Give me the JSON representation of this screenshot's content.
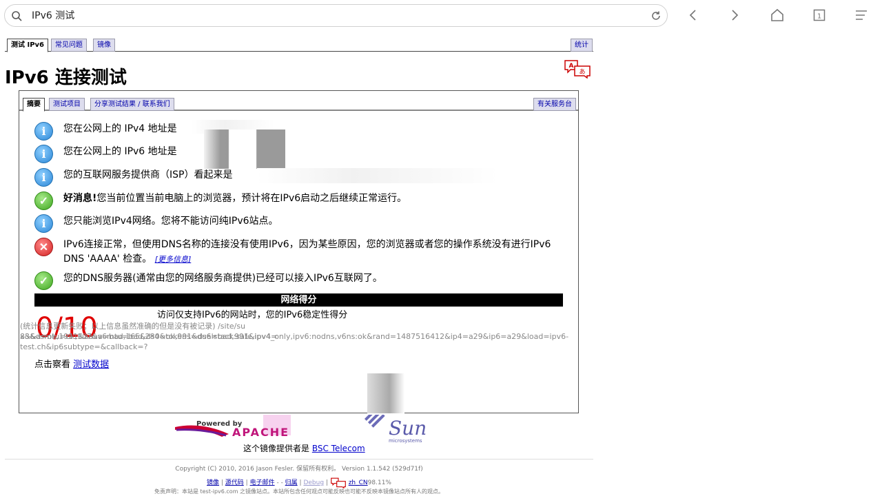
{
  "browser": {
    "url": "IPv6 测试"
  },
  "tabs": {
    "top": [
      "测试 IPv6",
      "常见问题",
      "镜像"
    ],
    "stats": "统计"
  },
  "page": {
    "title": "IPv6 连接测试"
  },
  "inner_tabs": {
    "items": [
      "摘要",
      "测试项目",
      "分享测试结果 / 联系我们"
    ],
    "helpdesk": "有关服务台"
  },
  "results": [
    {
      "icon": "info-icon",
      "text": "您在公网上的 IPv4 地址是"
    },
    {
      "icon": "info-icon",
      "text": "您在公网上的 IPv6 地址是"
    },
    {
      "icon": "info-icon",
      "text": "您的互联网服务提供商（ISP）看起来是"
    },
    {
      "icon": "check-icon",
      "bold": "好消息!",
      "text": "您当前位置当前电脑上的浏览器，预计将在IPv6启动之后继续正常运行。"
    },
    {
      "icon": "info-icon",
      "text": "您只能浏览IPv4网络。您将不能访问纯IPv6站点。"
    },
    {
      "icon": "error-icon",
      "text": "IPv6连接正常，但使用DNS名称的连接没有使用IPv6，因为某些原因，您的浏览器或者您的操作系统没有进行IPv6 DNS 'AAAA' 检查。",
      "link": "[更多信息]"
    },
    {
      "icon": "check-icon",
      "text": "您的DNS服务器(通常由您的网络服务商提供)已经可以接入IPv6互联网了。"
    }
  ],
  "score": {
    "header": "网络得分",
    "value": "0/10",
    "description": "访问仅支持IPv6的网站时，您的IPv6稳定性得分"
  },
  "testdata": {
    "prefix": "点击察看",
    "link": "测试数据"
  },
  "stats_line": {
    "part1": "(统计信息更新失败；以上信息虽然准确的但是没有被记录) /site/su",
    "part2": "x&&a=ok,1911&aaaa=bad,165&ds4=ok,991&ds6=bad,991&ipv4=",
    "part3": "83&dsmtu=ok,907&v6mtu=bad,280&tokens=dualstack:safe,ipv4_only,ipv6:nodns,v6ns:ok&rand=1487516412&ip4=a29&ip6=a29&load=ipv6-",
    "part4": "test.ch&ip6subtype=&callback=?"
  },
  "logos": {
    "powered_by": "Powered by",
    "apache": "APACHE",
    "sun": "Sun",
    "microsystems": "microsystems"
  },
  "mirror": {
    "prefix": "这个镜像提供者是",
    "link": "BSC Telecom"
  },
  "footer": {
    "copyright": "Copyright (C) 2010, 2016 Jason Fesler. 保留所有权利。 Version 1.1.542 (529d71f)",
    "links": [
      "镜像",
      "源代码",
      "电子邮件",
      "归属",
      "Debug"
    ],
    "locale": "zh_CN",
    "percent": "98.11%",
    "disclaimer": "免责声明：本站是 test-ipv6.com 之镜像站点。本站所包含任何观点可能反映也可能不反映本镜像站点所有人的观点。"
  }
}
